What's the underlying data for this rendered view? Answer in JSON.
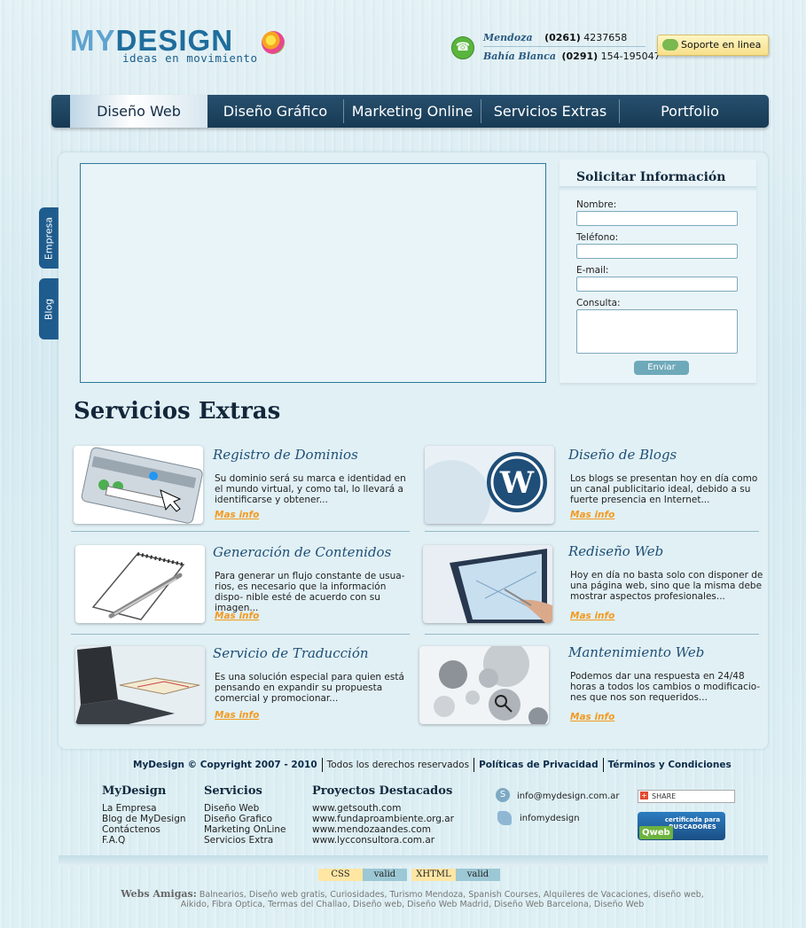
{
  "header": {
    "logo_my": "MY",
    "logo_design": "DESIGN",
    "logo_tagline": "ideas en movimiento",
    "phones": [
      {
        "city": "Mendoza",
        "code": "(0261)",
        "number": "4237658"
      },
      {
        "city": "Bahía Blanca",
        "code": "(0291)",
        "number": "154-195047"
      }
    ],
    "support_label": "Soporte en linea"
  },
  "nav": {
    "items": [
      "Diseño Web",
      "Diseño Gráfico",
      "Marketing Online",
      "Servicios Extras",
      "Portfolio"
    ],
    "active": "Diseño Web"
  },
  "side_tabs": [
    "Empresa",
    "Blog"
  ],
  "form": {
    "title": "Solicitar Información",
    "fields": [
      {
        "label": "Nombre:",
        "value": ""
      },
      {
        "label": "Teléfono:",
        "value": ""
      },
      {
        "label": "E-mail:",
        "value": ""
      },
      {
        "label": "Consulta:",
        "value": ""
      }
    ],
    "submit_label": "Enviar"
  },
  "services": {
    "section_title": "Servicios Extras",
    "more_label": "Mas info",
    "items": [
      {
        "title": "Registro de Dominios",
        "desc": "Su dominio será su marca e identidad en el mundo virtual, y como tal, lo llevará a identificarse y obtener...",
        "icon": "browser-address-bar-icon"
      },
      {
        "title": "Diseño de Blogs",
        "desc": "Los blogs se presentan hoy en día como un canal publicitario ideal, debido a su fuerte presencia en Internet...",
        "icon": "wordpress-icon"
      },
      {
        "title": "Generación de Contenidos",
        "desc": "Para generar un flujo constante de usua- rios, es necesario que la información dispo- nible esté de acuerdo con su imagen...",
        "icon": "notepad-pen-icon"
      },
      {
        "title": "Rediseño Web",
        "desc": "Hoy en día no basta solo con disponer de una página web, sino que la misma debe mostrar aspectos profesionales...",
        "icon": "touchscreen-icon"
      },
      {
        "title": "Servicio de Traducción",
        "desc": "Es una solución especial para quien está pensando en expandir su propuesta comercial y promocionar...",
        "icon": "laptop-book-icon"
      },
      {
        "title": "Mantenimiento Web",
        "desc": "Podemos dar una respuesta en 24/48 horas a todos los cambios o modificacio- nes que nos son requeridos...",
        "icon": "web-tools-icon"
      }
    ]
  },
  "footer": {
    "copyright": "MyDesign © Copyright 2007 - 2010",
    "rights": "Todos los derechos reservados",
    "privacy": "Políticas de Privacidad",
    "terms": "Términos y Condiciones",
    "columns": [
      {
        "title": "MyDesign",
        "links": [
          "La Empresa",
          "Blog de MyDesign",
          "Contáctenos",
          "F.A.Q"
        ]
      },
      {
        "title": "Servicios",
        "links": [
          "Diseño Web",
          "Diseño Grafico",
          "Marketing OnLine",
          "Servicios Extra"
        ]
      },
      {
        "title": "Proyectos Destacados",
        "links": [
          "www.getsouth.com",
          "www.fundaproambiente.org.ar",
          "www.mendozaandes.com",
          "www.lycconsultora.com.ar"
        ]
      }
    ],
    "email": "info@mydesign.com.ar",
    "messenger": "infomydesign",
    "share_label": "SHARE",
    "qweb_line1": "certificada para",
    "qweb_line2": "BUSCADORES",
    "qweb_logo": "Qweb",
    "badges": [
      {
        "name": "CSS",
        "status": "valid"
      },
      {
        "name": "XHTML",
        "status": "valid"
      }
    ],
    "amigas_label": "Webs Amigas:",
    "amigas_text": "Balnearios, Diseño web gratis, Curiosidades, Turismo Mendoza, Spanish Courses, Alquileres de Vacaciones, diseño web, Aikido, Fibra Optica, Termas del Challao, Diseño web, Diseño Web Madrid, Diseño Web Barcelona, Diseño Web"
  }
}
